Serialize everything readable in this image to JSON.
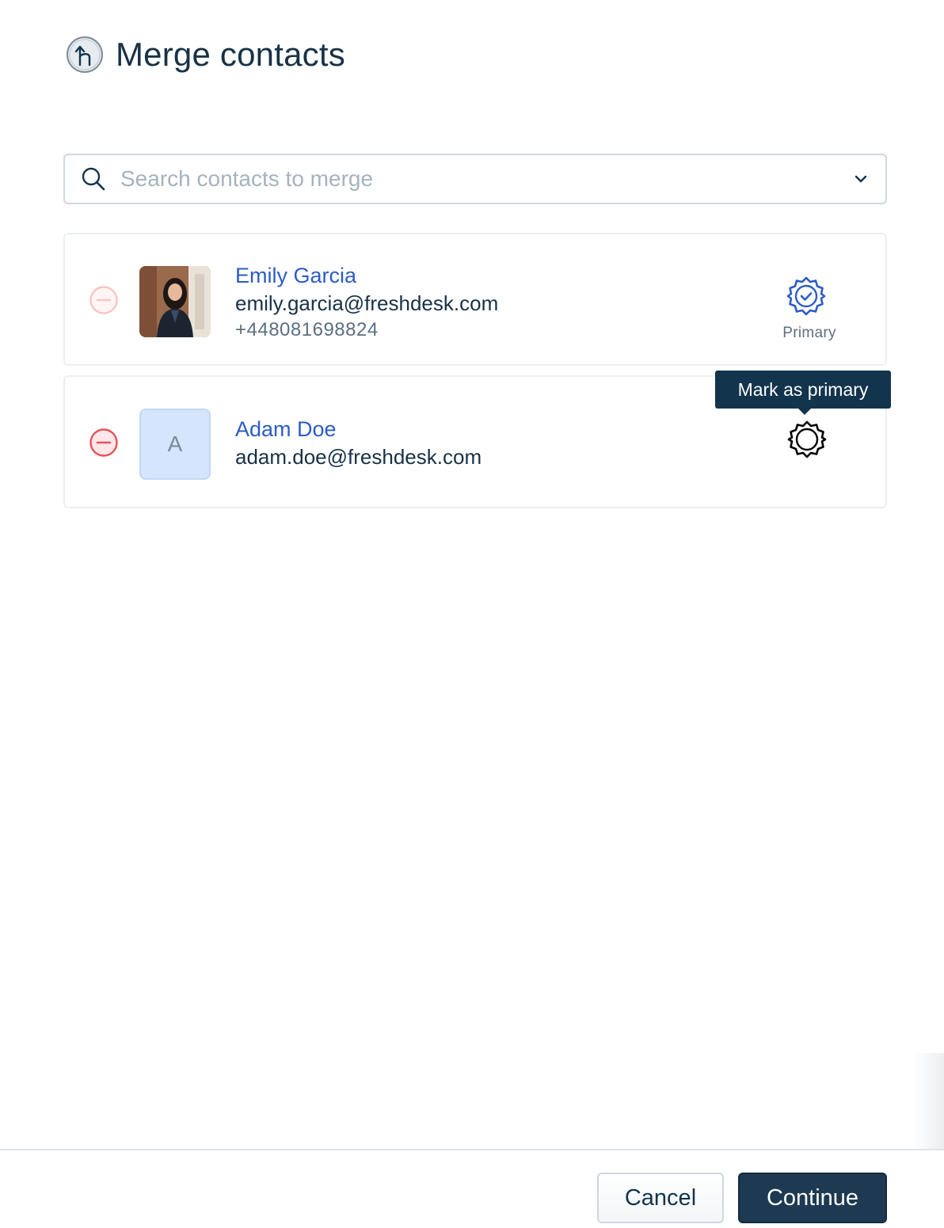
{
  "dialog": {
    "title": "Merge contacts"
  },
  "search": {
    "placeholder": "Search contacts to merge"
  },
  "contacts": [
    {
      "name": "Emily Garcia",
      "email": "emily.garcia@freshdesk.com",
      "phone": "+448081698824",
      "is_primary": true,
      "primary_label": "Primary"
    },
    {
      "name": "Adam Doe",
      "email": "adam.doe@freshdesk.com",
      "avatar_initial": "A",
      "is_primary": false
    }
  ],
  "tooltip": {
    "text": "Mark as primary"
  },
  "footer": {
    "cancel_label": "Cancel",
    "continue_label": "Continue"
  },
  "colors": {
    "link": "#2c5cc5",
    "primary_button": "#1d3a52",
    "remove_active": "#e5535b",
    "remove_disabled": "#f8c4c6"
  }
}
